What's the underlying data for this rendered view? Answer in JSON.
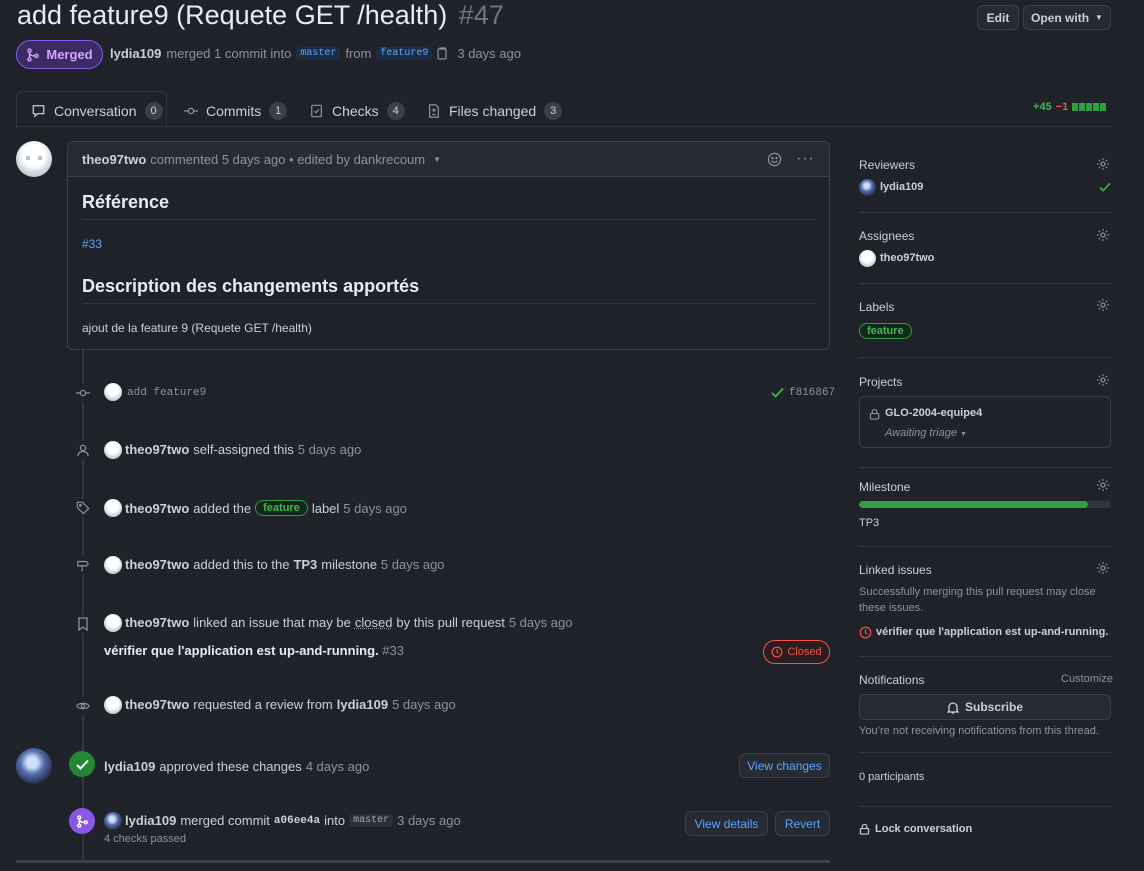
{
  "pr": {
    "title": "add feature9 (Requete GET /health)",
    "number": "#47",
    "state": "Merged",
    "author": "lydia109",
    "merge_text": "merged 1 commit into",
    "base_branch": "master",
    "from_text": "from",
    "head_branch": "feature9",
    "time": "3 days ago"
  },
  "header_buttons": {
    "edit": "Edit",
    "open_with": "Open with"
  },
  "tabs": [
    {
      "label": "Conversation",
      "count": "0"
    },
    {
      "label": "Commits",
      "count": "1"
    },
    {
      "label": "Checks",
      "count": "4"
    },
    {
      "label": "Files changed",
      "count": "3"
    }
  ],
  "diffstat": {
    "additions": "+45",
    "deletions": "−1"
  },
  "comment": {
    "author": "theo97two",
    "meta": "commented 5 days ago • edited by dankrecoum",
    "h1": "Référence",
    "ref_link": "#33",
    "h2": "Description des changements apportés",
    "body": "ajout de la feature 9 (Requete GET /health)"
  },
  "timeline": {
    "commit": {
      "message": "add feature9",
      "sha": "f816867"
    },
    "self_assign": {
      "user": "theo97two",
      "text": "self-assigned this",
      "time": "5 days ago"
    },
    "label_event": {
      "user": "theo97two",
      "text": "added the",
      "label": "feature",
      "text2": "label",
      "time": "5 days ago"
    },
    "milestone_event": {
      "user": "theo97two",
      "text": "added this to the",
      "milestone": "TP3",
      "text2": "milestone",
      "time": "5 days ago"
    },
    "link_event": {
      "user": "theo97two",
      "text1": "linked an issue that may be",
      "closed_word": "closed",
      "text2": "by this pull request",
      "time": "5 days ago",
      "issue_title": "vérifier que l'application est up-and-running.",
      "issue_number": "#33",
      "issue_state": "Closed"
    },
    "review_request": {
      "user": "theo97two",
      "text": "requested a review from",
      "reviewer": "lydia109",
      "time": "5 days ago"
    },
    "approval": {
      "user": "lydia109",
      "text": "approved these changes",
      "time": "4 days ago",
      "button": "View changes"
    },
    "merge": {
      "user": "lydia109",
      "text": "merged commit",
      "sha": "a06ee4a",
      "into": "into",
      "branch": "master",
      "time": "3 days ago",
      "checks": "4 checks passed",
      "details_button": "View details",
      "revert_button": "Revert"
    }
  },
  "sidebar": {
    "reviewers": {
      "heading": "Reviewers",
      "user": "lydia109"
    },
    "assignees": {
      "heading": "Assignees",
      "user": "theo97two"
    },
    "labels": {
      "heading": "Labels",
      "label": "feature"
    },
    "projects": {
      "heading": "Projects",
      "name": "GLO-2004-equipe4",
      "status": "Awaiting triage"
    },
    "milestone": {
      "heading": "Milestone",
      "name": "TP3",
      "progress": 0.91
    },
    "linked_issues": {
      "heading": "Linked issues",
      "description": "Successfully merging this pull request may close these issues.",
      "issue": "vérifier que l'application est up-and-running."
    },
    "notifications": {
      "heading": "Notifications",
      "customize": "Customize",
      "button": "Subscribe",
      "note": "You’re not receiving notifications from this thread."
    },
    "participants": "0 participants",
    "lock": "Lock conversation"
  },
  "colors": {
    "merged": "#8957e5",
    "approved": "#238636",
    "closed": "#f85149",
    "link": "#58a6ff",
    "label": "#3fb950"
  }
}
